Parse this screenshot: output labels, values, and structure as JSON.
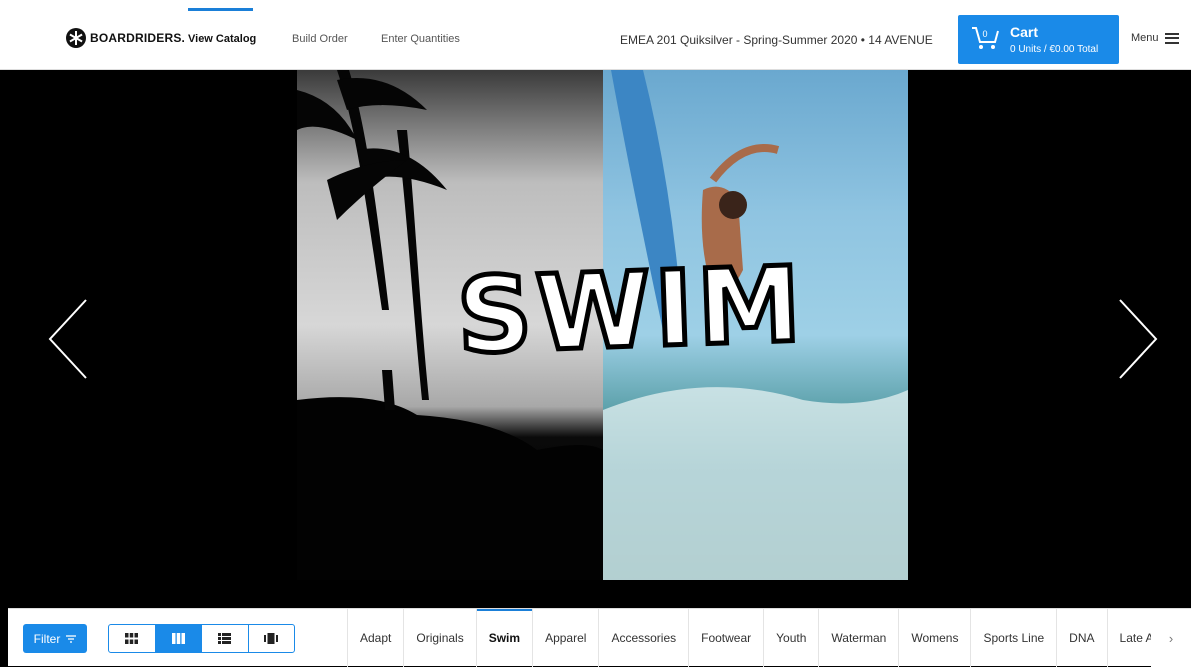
{
  "header": {
    "brand": "BOARDRIDERS.",
    "nav": [
      {
        "label": "View Catalog",
        "active": true
      },
      {
        "label": "Build Order",
        "active": false
      },
      {
        "label": "Enter Quantities",
        "active": false
      }
    ],
    "season": "EMEA 201 Quiksilver - Spring-Summer 2020 • 14 AVENUE",
    "cart": {
      "badge": "0",
      "title": "Cart",
      "summary": "0 Units / €0.00 Total"
    },
    "menu_label": "Menu"
  },
  "hero": {
    "title": "SWIM"
  },
  "toolbar": {
    "filter_label": "Filter",
    "views": [
      {
        "icon": "grid-small-icon",
        "active": false
      },
      {
        "icon": "grid-large-icon",
        "active": true
      },
      {
        "icon": "list-view-icon",
        "active": false
      },
      {
        "icon": "carousel-view-icon",
        "active": false
      }
    ],
    "tabs": [
      {
        "label": "Adapt",
        "active": false
      },
      {
        "label": "Originals",
        "active": false
      },
      {
        "label": "Swim",
        "active": true
      },
      {
        "label": "Apparel",
        "active": false
      },
      {
        "label": "Accessories",
        "active": false
      },
      {
        "label": "Footwear",
        "active": false
      },
      {
        "label": "Youth",
        "active": false
      },
      {
        "label": "Waterman",
        "active": false
      },
      {
        "label": "Womens",
        "active": false
      },
      {
        "label": "Sports Line",
        "active": false
      },
      {
        "label": "DNA",
        "active": false
      },
      {
        "label": "Late Ad",
        "active": false
      }
    ]
  },
  "colors": {
    "accent": "#1a8ae8"
  }
}
